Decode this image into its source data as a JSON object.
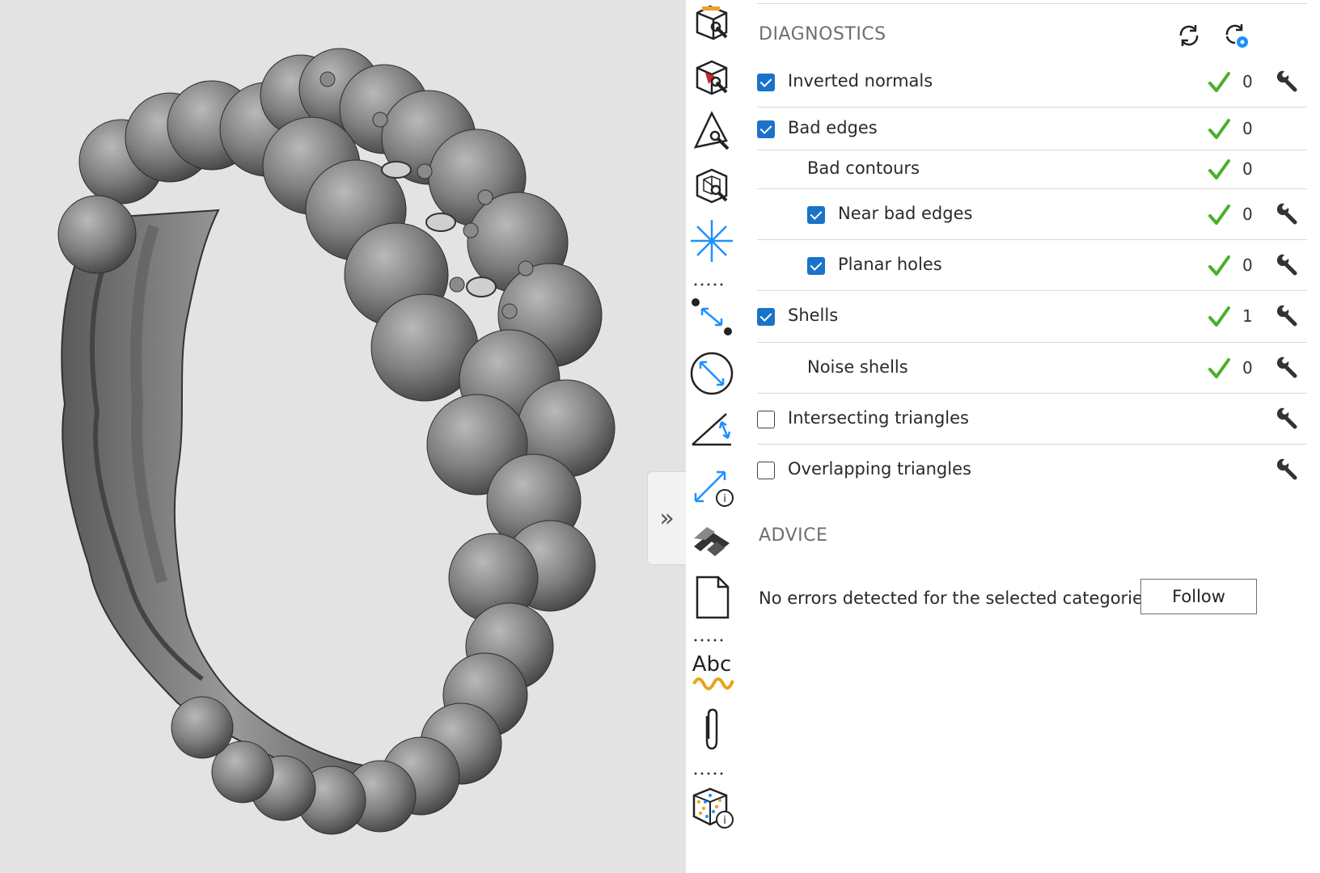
{
  "viewport": {
    "collapse_glyph": "»"
  },
  "toolbar": {
    "tools": [
      {
        "icon": "box-wrench-icon"
      },
      {
        "icon": "cube-red-face-icon"
      },
      {
        "icon": "triangle-wrench-icon"
      },
      {
        "icon": "wireframe-cube-wrench-icon"
      },
      {
        "icon": "star-burst-icon"
      },
      {
        "icon": "point-distance-icon"
      },
      {
        "icon": "diameter-measure-icon"
      },
      {
        "icon": "angle-measure-icon"
      },
      {
        "icon": "measure-info-icon"
      },
      {
        "icon": "stack-icon"
      },
      {
        "icon": "document-icon"
      },
      {
        "icon": "text-wave-icon",
        "text": "Abc"
      },
      {
        "icon": "paperclip-icon"
      },
      {
        "icon": "cube-info-icon"
      }
    ]
  },
  "diagnostics": {
    "title": "DIAGNOSTICS",
    "refresh_icon": "refresh-icon",
    "refresh_settings_icon": "refresh-settings-icon",
    "rows": [
      {
        "label": "Inverted normals",
        "checkbox": "checked",
        "ok": true,
        "count": "0",
        "wrench": true
      },
      {
        "label": "Bad edges",
        "checkbox": "checked",
        "ok": true,
        "count": "0",
        "wrench": false
      },
      {
        "label": "Bad contours",
        "checkbox": "none",
        "ok": true,
        "count": "0",
        "wrench": false
      },
      {
        "label": "Near bad edges",
        "checkbox": "checked",
        "ok": true,
        "count": "0",
        "wrench": true
      },
      {
        "label": "Planar holes",
        "checkbox": "checked",
        "ok": true,
        "count": "0",
        "wrench": true
      },
      {
        "label": "Shells",
        "checkbox": "checked",
        "ok": true,
        "count": "1",
        "wrench": true
      },
      {
        "label": "Noise shells",
        "checkbox": "none",
        "ok": true,
        "count": "0",
        "wrench": true
      },
      {
        "label": "Intersecting triangles",
        "checkbox": "unchecked",
        "ok": false,
        "count": "",
        "wrench": true
      },
      {
        "label": "Overlapping triangles",
        "checkbox": "unchecked",
        "ok": false,
        "count": "",
        "wrench": true
      }
    ]
  },
  "advice": {
    "title": "ADVICE",
    "message": "No errors detected for the selected categories.",
    "follow_label": "Follow"
  },
  "colors": {
    "accent": "#1a73c9",
    "ok_green": "#4caf2a",
    "viewport_bg": "#e3e3e3",
    "model_gray": "#7d7d7d"
  }
}
